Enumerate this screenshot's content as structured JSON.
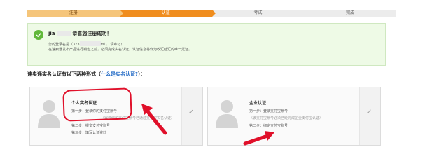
{
  "steps": [
    {
      "label": "注册",
      "state": "done"
    },
    {
      "label": "认证",
      "state": "active"
    },
    {
      "label": "考试",
      "state": "todo"
    },
    {
      "label": "完成",
      "state": "todo"
    }
  ],
  "success": {
    "name_prefix": "jia",
    "message": "恭喜您注册成功！",
    "line1_prefix": "您的登录名是（373",
    "line1_suffix": "m）， 请牢记！",
    "line2": "在速卖通发布产品进行销售之前，必须完成实名认证，认证信息将作为收汇结汇的唯一凭证。"
  },
  "heading": {
    "text": "速卖通实名认证有以下两种形式（",
    "link": "什么是实名认证?",
    "suffix": "）："
  },
  "cards": [
    {
      "title": "个人实名认证",
      "lines": [
        "第一步：登录你的支付宝账号",
        "第二步：提交支付宝账号",
        "第三步：填写认证资料"
      ],
      "note": "（需要你的支付宝账号已通过支付宝实名认证）"
    },
    {
      "title": "企业认证",
      "lines": [
        "第一步：登录支付宝账号",
        "第二步：绑定支付宝账号"
      ],
      "note": "（该支付宝账号必须已经完成企业支付宝认证）"
    }
  ],
  "colors": {
    "active_step": "#f08d1e",
    "success_bg": "#eefae6",
    "check": "#61b83a",
    "highlight": "#e0102a",
    "link": "#2a6fc7"
  }
}
